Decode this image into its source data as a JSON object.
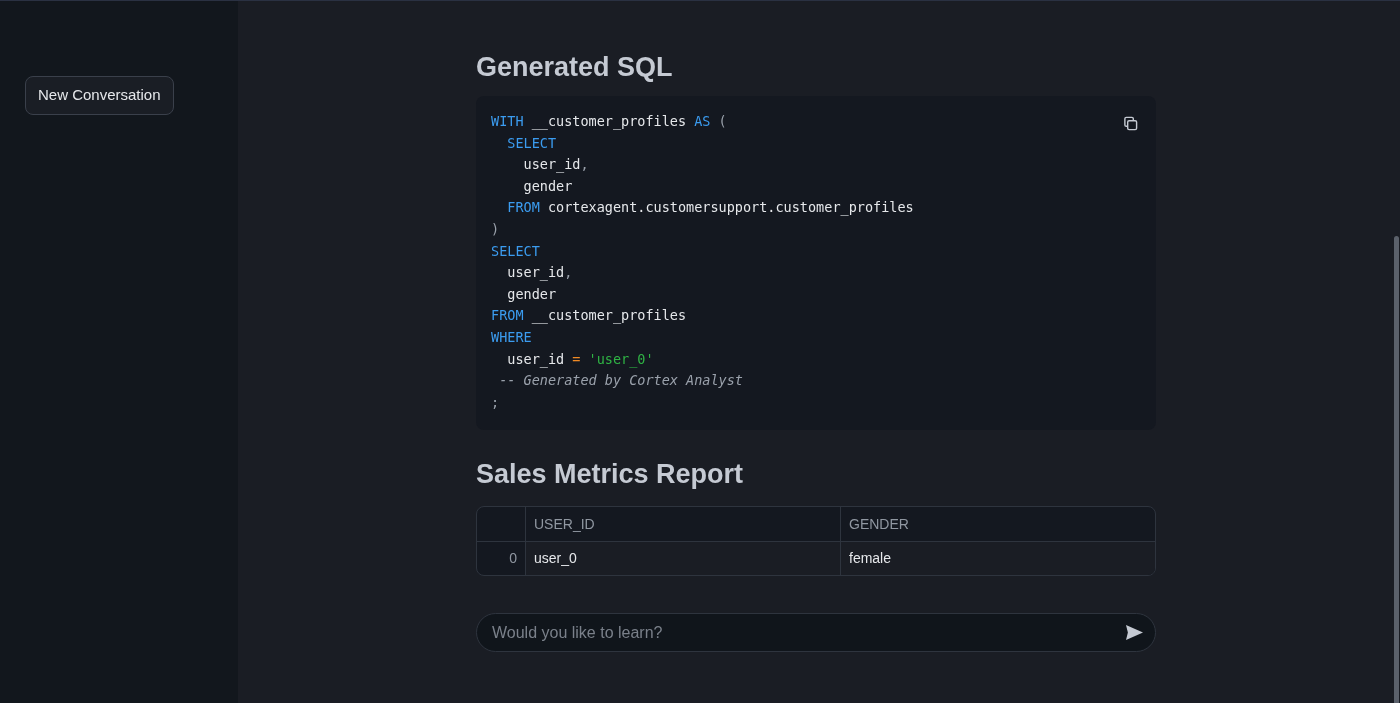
{
  "sidebar": {
    "new_conversation_button": "New Conversation"
  },
  "sql_section": {
    "title": "Generated SQL",
    "code_lines": [
      [
        {
          "kind": "keyword",
          "text": "WITH"
        },
        {
          "kind": "plain",
          "text": " __customer_profiles "
        },
        {
          "kind": "keyword",
          "text": "AS"
        },
        {
          "kind": "punct",
          "text": " ("
        }
      ],
      [
        {
          "kind": "keyword",
          "text": "  SELECT"
        }
      ],
      [
        {
          "kind": "plain",
          "text": "    user_id"
        },
        {
          "kind": "punct",
          "text": ","
        }
      ],
      [
        {
          "kind": "plain",
          "text": "    gender"
        }
      ],
      [
        {
          "kind": "keyword",
          "text": "  FROM"
        },
        {
          "kind": "plain",
          "text": " cortexagent.customersupport.customer_profiles"
        }
      ],
      [
        {
          "kind": "punct",
          "text": ")"
        }
      ],
      [
        {
          "kind": "keyword",
          "text": "SELECT"
        }
      ],
      [
        {
          "kind": "plain",
          "text": "  user_id"
        },
        {
          "kind": "punct",
          "text": ","
        }
      ],
      [
        {
          "kind": "plain",
          "text": "  gender"
        }
      ],
      [
        {
          "kind": "keyword",
          "text": "FROM"
        },
        {
          "kind": "plain",
          "text": " __customer_profiles"
        }
      ],
      [
        {
          "kind": "keyword",
          "text": "WHERE"
        }
      ],
      [
        {
          "kind": "plain",
          "text": "  user_id "
        },
        {
          "kind": "operator",
          "text": "="
        },
        {
          "kind": "string",
          "text": " 'user_0'"
        }
      ],
      [
        {
          "kind": "comment",
          "text": " -- Generated by Cortex Analyst"
        }
      ],
      [
        {
          "kind": "punct",
          "text": ";"
        }
      ]
    ]
  },
  "report": {
    "title": "Sales Metrics Report",
    "columns": [
      "USER_ID",
      "GENDER"
    ],
    "rows": [
      {
        "index": "0",
        "cells": [
          "user_0",
          "female"
        ]
      }
    ]
  },
  "chat_input": {
    "placeholder": "Would you like to learn?"
  }
}
